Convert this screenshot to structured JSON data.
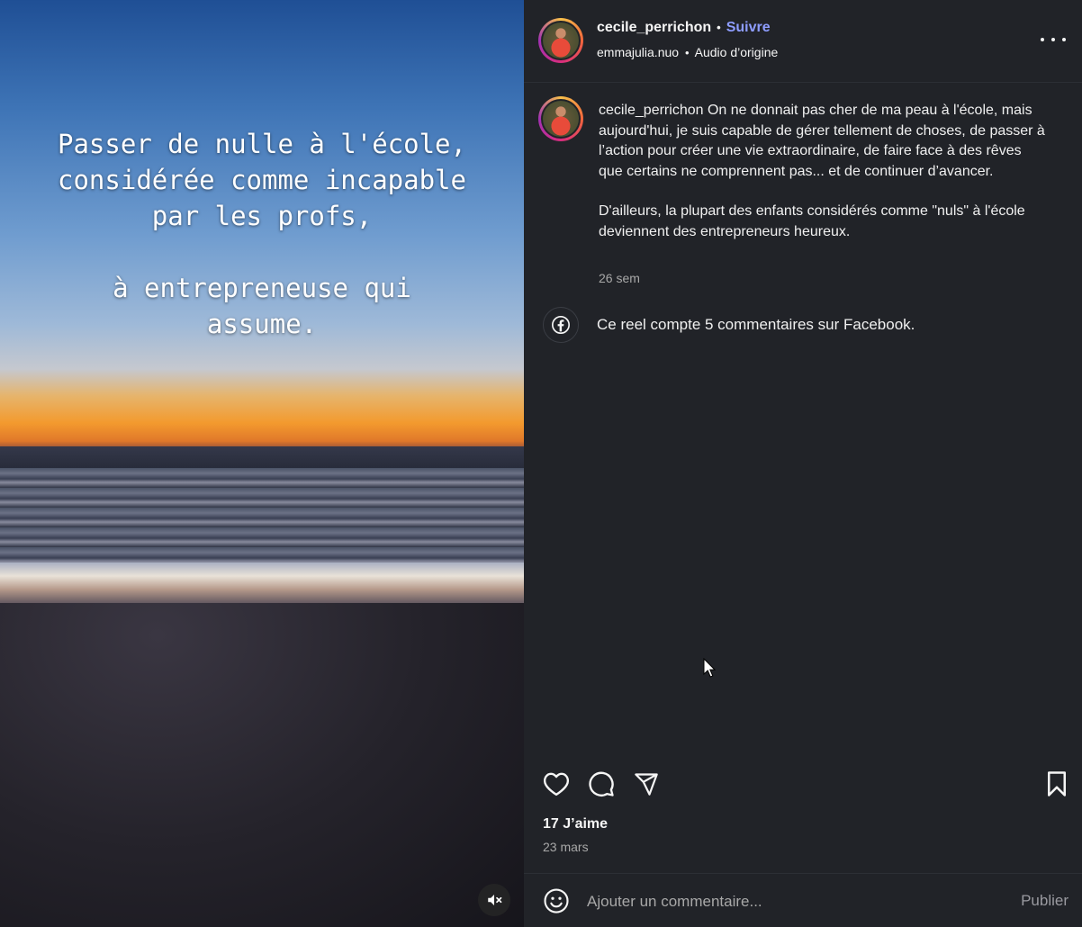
{
  "video": {
    "overlay_text": "Passer de nulle à l'école,\nconsidérée comme incapable\npar les profs,\n\n  à entrepreneuse qui\nassume.",
    "mute_icon": "speaker-muted-icon"
  },
  "header": {
    "username": "cecile_perrichon",
    "separator": "•",
    "follow_label": "Suivre",
    "audio_author": "emmajulia.nuo",
    "audio_separator": "•",
    "audio_label": "Audio d’origine",
    "more_icon": "more-options-icon"
  },
  "caption": {
    "username": "cecile_perrichon",
    "paragraph1": "On ne donnait pas cher de ma peau à l'école, mais aujourd'hui, je suis capable de gérer tellement de choses, de passer à l’action pour créer une vie extraordinaire, de faire face à des rêves que certains ne comprennent pas... et de continuer d’avancer.",
    "paragraph2": "D'ailleurs, la plupart des enfants considérés comme \"nuls\" à l'école deviennent des entrepreneurs heureux.",
    "time": "26 sem"
  },
  "facebook": {
    "icon": "facebook-icon",
    "text": "Ce reel compte 5 commentaires sur Facebook."
  },
  "actions": {
    "like_icon": "heart-icon",
    "comment_icon": "comment-icon",
    "share_icon": "send-icon",
    "save_icon": "bookmark-icon",
    "likes": "17 J’aime",
    "date": "23 mars"
  },
  "comment": {
    "emoji_icon": "emoji-icon",
    "placeholder": "Ajouter un commentaire...",
    "publish_label": "Publier"
  },
  "colors": {
    "background": "#212328",
    "accent": "#8e9dff",
    "text": "#f5f5f5",
    "muted": "#a8a8a8"
  }
}
